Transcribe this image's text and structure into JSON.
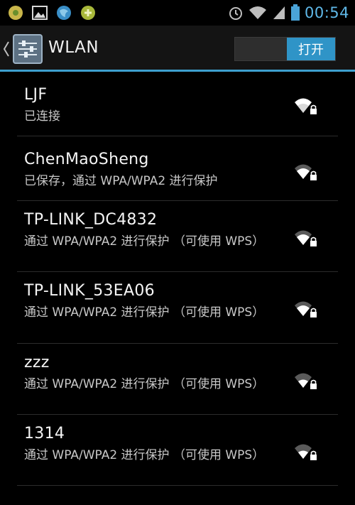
{
  "status_bar": {
    "time": "00:54",
    "icons": [
      "maps-icon",
      "gallery-icon",
      "browser-icon",
      "settings-app-icon",
      "alarm-icon",
      "wifi-status-icon",
      "signal-icon",
      "battery-icon"
    ]
  },
  "action_bar": {
    "title": "WLAN",
    "toggle_label": "打开"
  },
  "networks": [
    {
      "ssid": "LJF",
      "summary": "已连接",
      "secured": true,
      "strength": 4
    },
    {
      "ssid": "ChenMaoSheng",
      "summary": "已保存，通过 WPA/WPA2 进行保护",
      "secured": true,
      "strength": 3
    },
    {
      "ssid": "TP-LINK_DC4832",
      "summary": "通过 WPA/WPA2 进行保护 （可使用 WPS）",
      "secured": true,
      "strength": 3
    },
    {
      "ssid": "TP-LINK_53EA06",
      "summary": "通过 WPA/WPA2 进行保护 （可使用 WPS）",
      "secured": true,
      "strength": 3
    },
    {
      "ssid": "zzz",
      "summary": "通过 WPA/WPA2 进行保护 （可使用 WPS）",
      "secured": true,
      "strength": 2
    },
    {
      "ssid": "1314",
      "summary": "通过 WPA/WPA2 进行保护 （可使用 WPS）",
      "secured": true,
      "strength": 2
    }
  ],
  "colors": {
    "accent": "#3ea0cf",
    "clock": "#5fb8e8",
    "background": "#000000"
  }
}
